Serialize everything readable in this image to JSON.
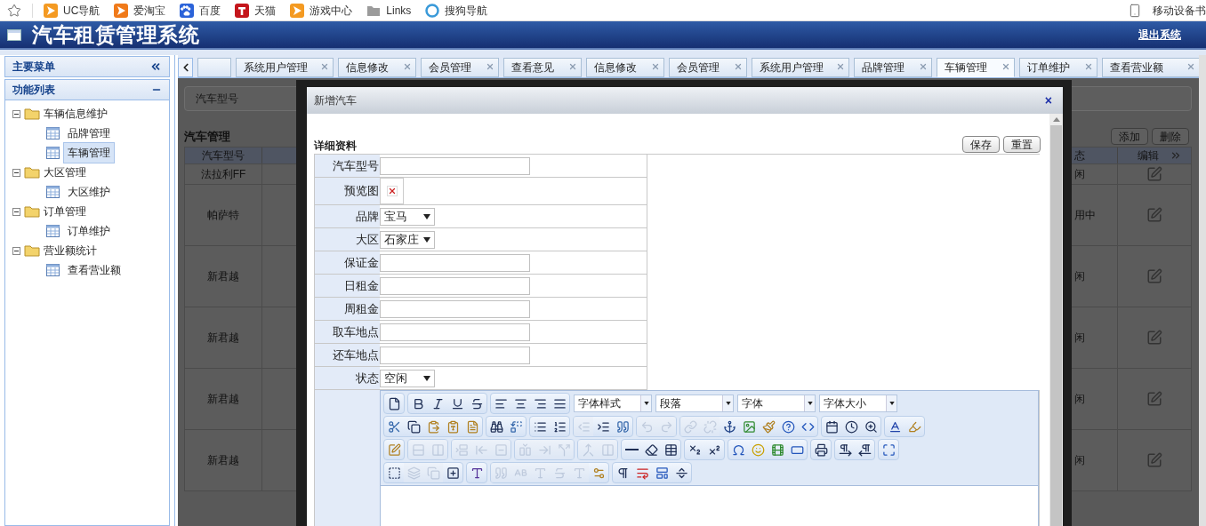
{
  "bookmarks": {
    "items": [
      "UC导航",
      "爱淘宝",
      "百度",
      "天猫",
      "游戏中心",
      "Links",
      "搜狗导航"
    ],
    "mobile": "移动设备书"
  },
  "header": {
    "title": "汽车租赁管理系统",
    "logout": "退出系统"
  },
  "sidebar": {
    "header": "主要菜单",
    "section": "功能列表",
    "tree": [
      {
        "label": "车辆信息维护",
        "expanded": true,
        "children": [
          {
            "label": "品牌管理",
            "selected": false
          },
          {
            "label": "车辆管理",
            "selected": true
          }
        ]
      },
      {
        "label": "大区管理",
        "expanded": true,
        "children": [
          {
            "label": "大区维护",
            "selected": false
          }
        ]
      },
      {
        "label": "订单管理",
        "expanded": true,
        "children": [
          {
            "label": "订单维护",
            "selected": false
          }
        ]
      },
      {
        "label": "营业额统计",
        "expanded": true,
        "children": [
          {
            "label": "查看营业额",
            "selected": false
          }
        ]
      }
    ]
  },
  "tabs": [
    {
      "label": "系统用户管理",
      "selected": false
    },
    {
      "label": "信息修改",
      "selected": false
    },
    {
      "label": "会员管理",
      "selected": false
    },
    {
      "label": "查看意见",
      "selected": false
    },
    {
      "label": "信息修改",
      "selected": false
    },
    {
      "label": "会员管理",
      "selected": false
    },
    {
      "label": "系统用户管理",
      "selected": false
    },
    {
      "label": "品牌管理",
      "selected": false
    },
    {
      "label": "车辆管理",
      "selected": true
    },
    {
      "label": "订单维护",
      "selected": false
    },
    {
      "label": "查看营业额",
      "selected": false
    }
  ],
  "background": {
    "search_label": "汽车型号",
    "heading": "汽车管理",
    "buttons": [
      "添加",
      "删除"
    ],
    "columns": [
      "汽车型号",
      "态",
      "编辑"
    ],
    "rows": [
      {
        "model": "法拉利FF",
        "status": "闲"
      },
      {
        "model": "帕萨特",
        "status": "用中"
      },
      {
        "model": "新君越",
        "status": "闲"
      },
      {
        "model": "新君越",
        "status": "闲"
      },
      {
        "model": "新君越",
        "status": "闲"
      },
      {
        "model": "新君越",
        "status": "闲"
      }
    ]
  },
  "dialog": {
    "title": "新增汽车",
    "close": "×",
    "section": "详细资料",
    "buttons": [
      "保存",
      "重置"
    ],
    "fields": [
      {
        "label": "汽车型号",
        "kind": "text"
      },
      {
        "label": "预览图",
        "kind": "image"
      },
      {
        "label": "品牌",
        "kind": "select",
        "value": "宝马"
      },
      {
        "label": "大区",
        "kind": "select",
        "value": "石家庄"
      },
      {
        "label": "保证金",
        "kind": "text"
      },
      {
        "label": "日租金",
        "kind": "text"
      },
      {
        "label": "周租金",
        "kind": "text"
      },
      {
        "label": "取车地点",
        "kind": "text"
      },
      {
        "label": "还车地点",
        "kind": "text"
      },
      {
        "label": "状态",
        "kind": "select",
        "value": "空闲"
      }
    ],
    "editor": {
      "dropdowns": [
        "字体样式",
        "段落",
        "字体",
        "字体大小"
      ],
      "toolbar": [
        [
          [
            {
              "disabled": false
            }
          ],
          [
            {
              "disabled": false
            },
            {
              "disabled": false
            },
            {
              "disabled": false
            },
            {
              "disabled": false
            }
          ],
          [
            {
              "disabled": false
            },
            {
              "disabled": false
            },
            {
              "disabled": false
            },
            {
              "disabled": false
            }
          ]
        ],
        [
          [
            {
              "disabled": false
            },
            {
              "disabled": false
            },
            {
              "disabled": false
            },
            {
              "disabled": false
            },
            {
              "disabled": false
            }
          ],
          [
            {
              "disabled": false
            },
            {
              "disabled": false
            }
          ],
          [
            {
              "disabled": false
            },
            {
              "disabled": false
            }
          ],
          [
            {
              "disabled": true
            },
            {
              "disabled": false
            },
            {
              "disabled": false
            }
          ],
          [
            {
              "disabled": true
            },
            {
              "disabled": true
            }
          ],
          [
            {
              "disabled": true
            },
            {
              "disabled": true
            },
            {
              "disabled": false
            },
            {
              "disabled": false
            },
            {
              "disabled": false
            },
            {
              "disabled": false
            },
            {
              "disabled": false
            }
          ],
          [
            {
              "disabled": false
            },
            {
              "disabled": false
            },
            {
              "disabled": false
            }
          ],
          [
            {
              "disabled": false
            },
            {
              "disabled": false
            }
          ]
        ],
        [
          [
            {
              "disabled": false
            }
          ],
          [
            {
              "disabled": true
            },
            {
              "disabled": true
            }
          ],
          [
            {
              "disabled": true
            },
            {
              "disabled": true
            },
            {
              "disabled": true
            }
          ],
          [
            {
              "disabled": true
            },
            {
              "disabled": true
            },
            {
              "disabled": true
            }
          ],
          [
            {
              "disabled": true
            },
            {
              "disabled": true
            }
          ],
          [
            {
              "disabled": false
            },
            {
              "disabled": false
            },
            {
              "disabled": false
            }
          ],
          [
            {
              "disabled": false
            },
            {
              "disabled": false
            }
          ],
          [
            {
              "disabled": false
            },
            {
              "disabled": false
            },
            {
              "disabled": false
            },
            {
              "disabled": false
            }
          ],
          [
            {
              "disabled": false
            }
          ],
          [
            {
              "disabled": false
            },
            {
              "disabled": false
            }
          ],
          [
            {
              "disabled": false
            }
          ]
        ],
        [
          [
            {
              "disabled": false
            },
            {
              "disabled": true
            },
            {
              "disabled": true
            },
            {
              "disabled": false
            }
          ],
          [
            {
              "disabled": false
            }
          ],
          [
            {
              "disabled": true
            },
            {
              "disabled": true
            },
            {
              "disabled": true
            },
            {
              "disabled": true
            },
            {
              "disabled": true
            },
            {
              "disabled": false
            }
          ],
          [
            {
              "disabled": false
            },
            {
              "disabled": false
            },
            {
              "disabled": false
            },
            {
              "disabled": false
            }
          ]
        ]
      ]
    }
  }
}
